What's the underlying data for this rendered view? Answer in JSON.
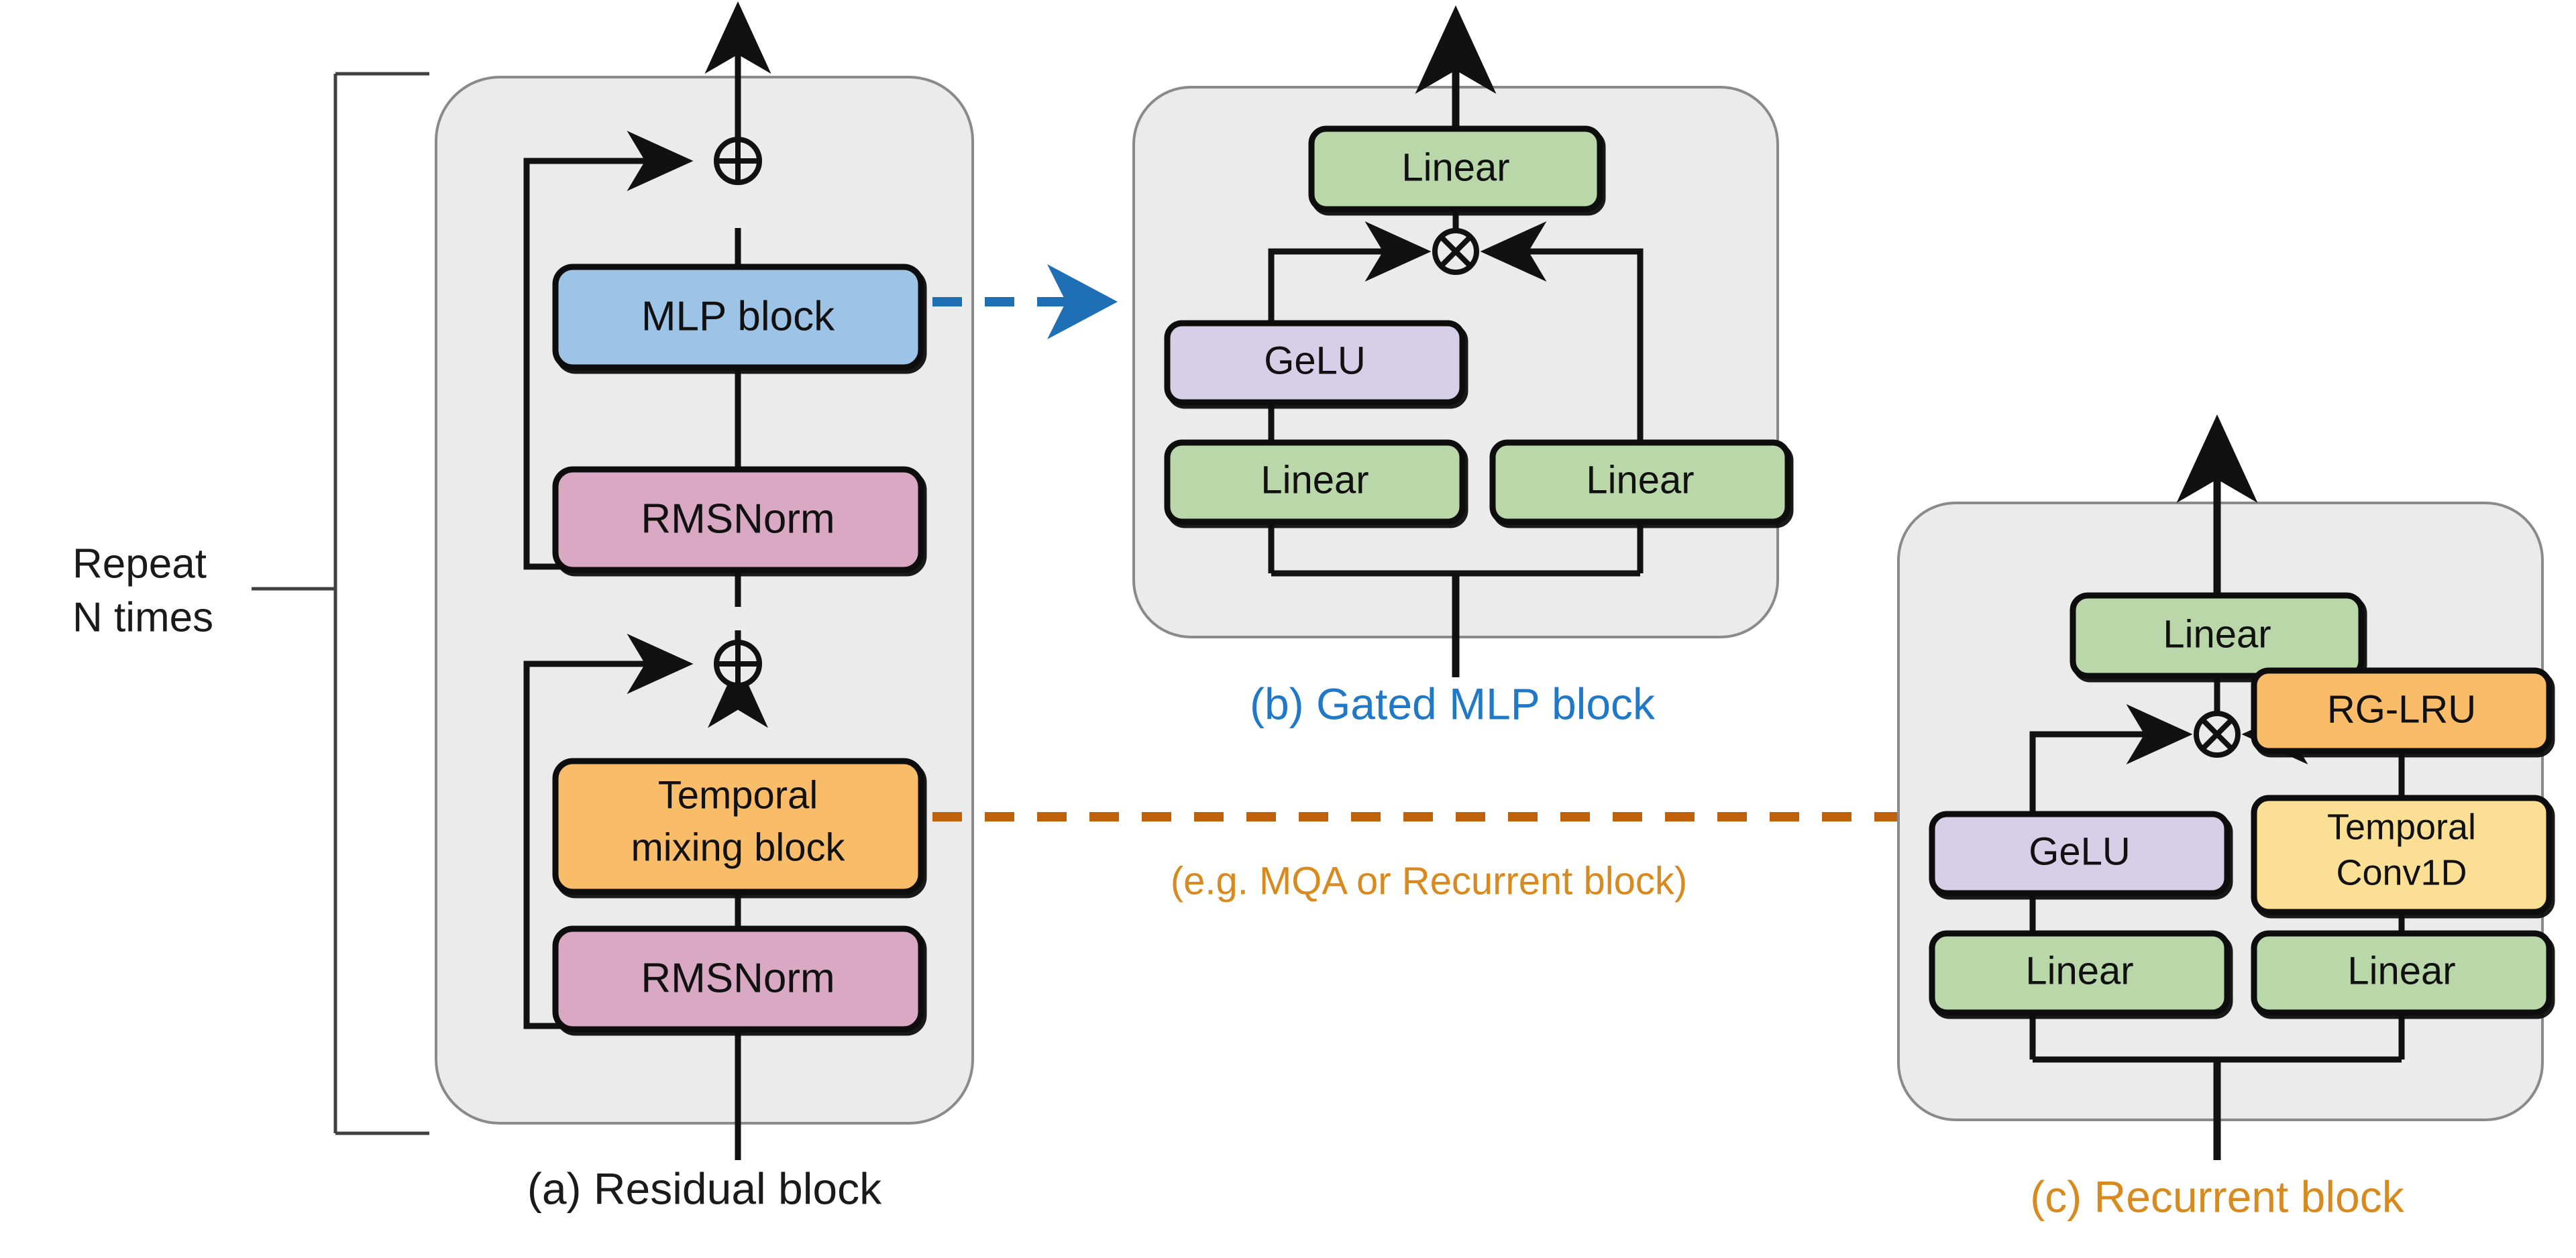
{
  "figure": {
    "labels": {
      "repeat_line1": "Repeat",
      "repeat_line2": "N times",
      "mixing_hint": "(e.g. MQA or Recurrent block)"
    },
    "captions": {
      "a": "(a) Residual block",
      "b": "(b) Gated MLP block",
      "c": "(c) Recurrent block"
    },
    "colors": {
      "panel_fill": "#ebebeb",
      "panel_stroke": "#808080",
      "stroke": "#111111",
      "blue_block": "#9dc3e6",
      "pink_block": "#d9a8c2",
      "green_block": "#b9d7a8",
      "purple_block": "#d6cfe8",
      "orange_block": "#f9bd6a",
      "yellow_block": "#fbdf95",
      "caption_a": "#1a1a1a",
      "caption_b": "#1f78c8",
      "caption_c": "#d98a1e",
      "arrow_blue": "#1f6fb4",
      "arrow_orange": "#c0600a",
      "hint_text": "#d98a1e"
    },
    "panel_a": {
      "blocks": [
        {
          "id": "mlp-block",
          "label": "MLP block",
          "color": "blue_block"
        },
        {
          "id": "rmsnorm-top",
          "label": "RMSNorm",
          "color": "pink_block"
        },
        {
          "id": "temporal-mixing-block",
          "label_line1": "Temporal",
          "label_line2": "mixing block",
          "color": "orange_block"
        },
        {
          "id": "rmsnorm-bottom",
          "label": "RMSNorm",
          "color": "pink_block"
        }
      ],
      "operators": [
        "plus",
        "plus"
      ]
    },
    "panel_b": {
      "blocks": [
        {
          "id": "linear-out",
          "label": "Linear",
          "color": "green_block"
        },
        {
          "id": "gelu",
          "label": "GeLU",
          "color": "purple_block"
        },
        {
          "id": "linear-left",
          "label": "Linear",
          "color": "green_block"
        },
        {
          "id": "linear-right",
          "label": "Linear",
          "color": "green_block"
        }
      ],
      "operators": [
        "times"
      ]
    },
    "panel_c": {
      "blocks": [
        {
          "id": "linear-out",
          "label": "Linear",
          "color": "green_block"
        },
        {
          "id": "rg-lru",
          "label": "RG-LRU",
          "color": "orange_block"
        },
        {
          "id": "gelu",
          "label": "GeLU",
          "color": "purple_block"
        },
        {
          "id": "temporal-conv1d",
          "label_line1": "Temporal",
          "label_line2": "Conv1D",
          "color": "yellow_block"
        },
        {
          "id": "linear-left",
          "label": "Linear",
          "color": "green_block"
        },
        {
          "id": "linear-right",
          "label": "Linear",
          "color": "green_block"
        }
      ],
      "operators": [
        "times"
      ]
    }
  }
}
